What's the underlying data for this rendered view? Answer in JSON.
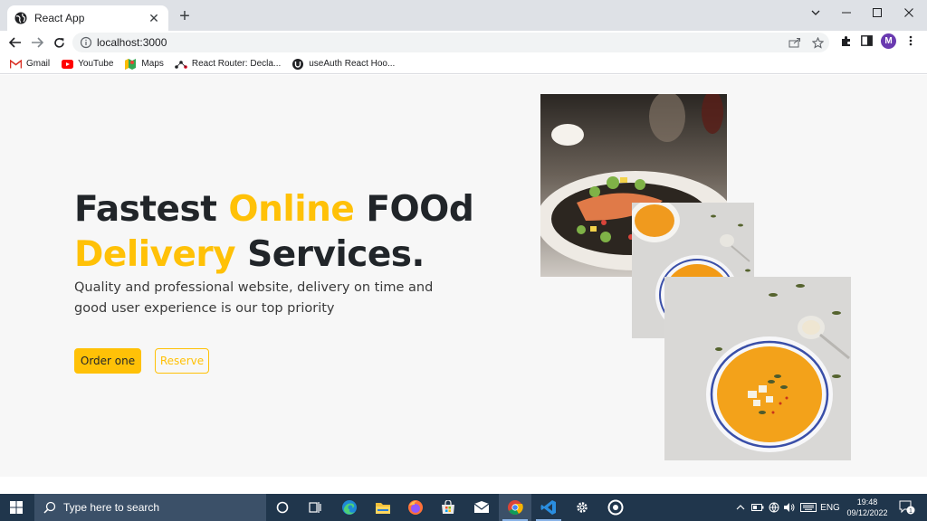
{
  "browser": {
    "tab_title": "React App",
    "close_label": "✕",
    "new_tab_label": "+",
    "url": "localhost:3000",
    "profile_initial": "M",
    "bookmarks": [
      {
        "label": "Gmail",
        "icon": "gmail-icon"
      },
      {
        "label": "YouTube",
        "icon": "youtube-icon"
      },
      {
        "label": "Maps",
        "icon": "maps-icon"
      },
      {
        "label": "React Router: Decla...",
        "icon": "react-router-icon"
      },
      {
        "label": "useAuth React Hoo...",
        "icon": "useauth-icon"
      }
    ]
  },
  "hero": {
    "title_part1": "Fastest ",
    "title_accent1": "Online",
    "title_part2": " FOOd",
    "title_accent2": "Delivery",
    "title_part3": " Services.",
    "subtitle": "Quality and professional website, delivery on time and good user experience is our top priority",
    "order_button": "Order one",
    "reserve_button": "Reserve"
  },
  "images": [
    {
      "name": "salmon-dish-image"
    },
    {
      "name": "pumpkin-soup-image-small"
    },
    {
      "name": "pumpkin-soup-image-large"
    }
  ],
  "taskbar": {
    "search_placeholder": "Type here to search",
    "language": "ENG",
    "time": "19:48",
    "date": "09/12/2022",
    "notification_count": "1"
  },
  "colors": {
    "accent": "#ffc107",
    "text": "#212529",
    "page_bg": "#f7f7f7",
    "taskbar_bg": "#20364c"
  }
}
